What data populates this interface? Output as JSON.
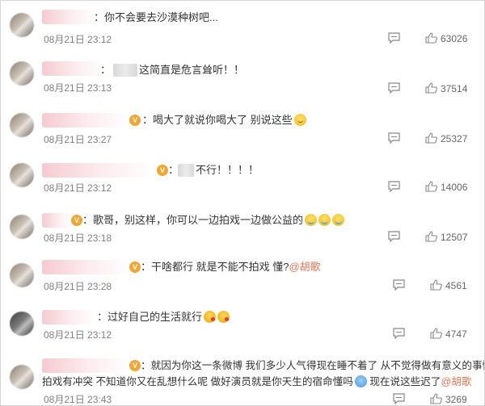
{
  "comments": [
    {
      "text": "你不会要去沙漠种树吧...",
      "time": "08月21日 23:12",
      "likes": "63026"
    },
    {
      "text": "这简直是危言耸听！！",
      "time": "08月21日 23:13",
      "likes": "37514"
    },
    {
      "text": "喝大了就说你喝大了 别说这些",
      "time": "08月21日 23:27",
      "likes": "25327"
    },
    {
      "text": "不行！！！！",
      "time": "08月21日 23:12",
      "likes": "14006"
    },
    {
      "text": "歌哥，别这样，你可以一边拍戏一边做公益的",
      "time": "08月21日 23:18",
      "likes": "12507"
    },
    {
      "text": "干啥都行 就是不能不拍戏 懂?",
      "mention": "@胡歌",
      "time": "08月21日 23:28",
      "likes": "4561"
    },
    {
      "text": "过好自己的生活就行",
      "time": "08月21日 23:12",
      "likes": "4747"
    },
    {
      "text_line1": "就因为你这一条微博 我们多少人气得现在睡不着了 从不觉得做有意义的事情跟",
      "text_line2a": "拍戏有冲突 不知道你又在乱想什么呢 做好演员就是你天生的宿命懂吗",
      "text_line2b": "现在说这些迟了",
      "mention": "@胡歌",
      "time": "08月21日 23:43",
      "likes": "3269"
    }
  ],
  "colors": {
    "mention": "#eb7350",
    "badge": "#f3a531",
    "time": "#808080"
  },
  "icons": {
    "comment": "comment-bubble-icon",
    "like": "thumbs-up-icon",
    "badge": "vip-badge-icon"
  }
}
